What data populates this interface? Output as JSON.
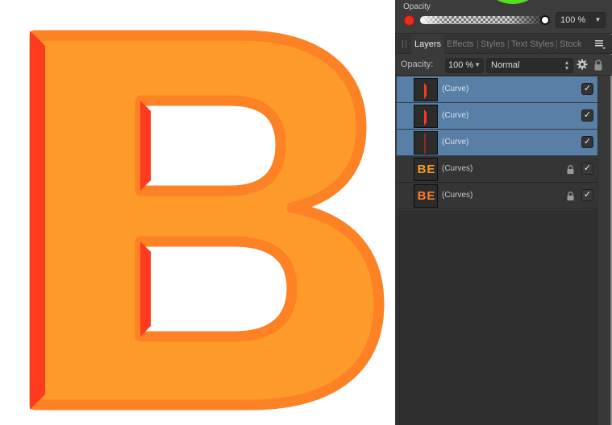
{
  "colors": {
    "letter_fill": "#fd9a2a",
    "letter_stroke": "#fd8125",
    "bevel": "#ff3b1f",
    "canvas_bg": "#ffffff",
    "panel_bg": "#3a3a3a",
    "selection": "#5a7fa6",
    "current_color": "#ee2a1c"
  },
  "canvas": {
    "letter": "B"
  },
  "color_panel": {
    "opacity_label": "Opacity",
    "opacity_slider_value_percent": 100,
    "opacity_value": "100 %",
    "dropdown_icon": "triangle-down"
  },
  "tabs": [
    {
      "label": "Layers",
      "active": true
    },
    {
      "label": "Effects",
      "active": false
    },
    {
      "label": "Styles",
      "active": false
    },
    {
      "label": "Text Styles",
      "active": false
    },
    {
      "label": "Stock",
      "active": false
    }
  ],
  "panel_menu_icon": "≡",
  "layers_toolbar": {
    "opacity_label": "Opacity:",
    "opacity_value": "100 %",
    "blend_mode": "Normal"
  },
  "layers": [
    {
      "name": "(Curve)",
      "selected": true,
      "locked": false,
      "visible": true,
      "thumb": "thick-red-bar"
    },
    {
      "name": "(Curve)",
      "selected": true,
      "locked": false,
      "visible": true,
      "thumb": "thick-red-bar"
    },
    {
      "name": "(Curve)",
      "selected": true,
      "locked": false,
      "visible": true,
      "thumb": "thin-dark-red-bar"
    },
    {
      "name": "(Curves)",
      "selected": false,
      "locked": true,
      "visible": true,
      "thumb": "BE",
      "thumb_color": "#f79a23"
    },
    {
      "name": "(Curves)",
      "selected": false,
      "locked": true,
      "visible": true,
      "thumb": "BE",
      "thumb_color": "#fa8128"
    }
  ],
  "checkmark": "✓"
}
